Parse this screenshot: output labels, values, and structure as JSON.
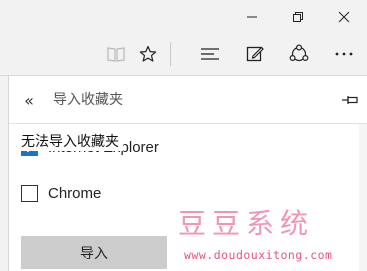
{
  "toolbar": {
    "icons": [
      "reading-view-icon",
      "favorites-star-icon",
      "hub-icon",
      "web-note-icon",
      "share-icon",
      "more-icon"
    ]
  },
  "titlebar": {
    "icons": [
      "minimize-icon",
      "restore-icon",
      "close-icon"
    ]
  },
  "panel": {
    "back_glyph": "«",
    "title": "导入收藏夹",
    "section_heading": "无法导入收藏夹",
    "options": [
      {
        "label": "Internet Explorer",
        "checked": true
      },
      {
        "label": "Chrome",
        "checked": false
      }
    ],
    "import_button": "导入"
  },
  "watermark": {
    "title": "豆豆系统",
    "url": "www.doudouxitong.com"
  },
  "colors": {
    "accent": "#1a73c8",
    "button_bg": "#cccccc",
    "watermark": "#e8547a"
  }
}
